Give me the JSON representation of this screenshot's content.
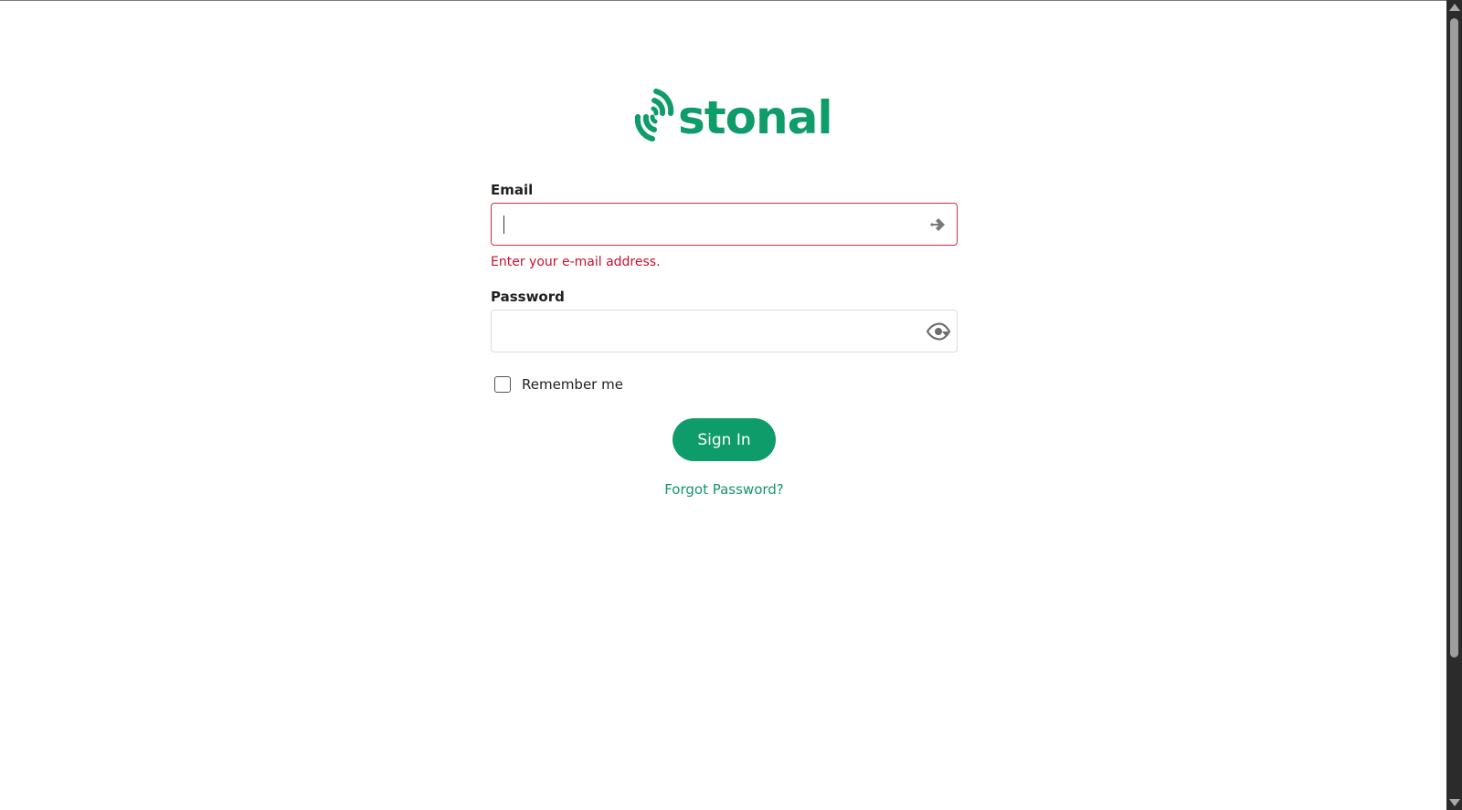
{
  "brand": {
    "name": "stonal",
    "color": "#0e9c6a",
    "logo_icon": "signal-waves-icon"
  },
  "form": {
    "email": {
      "label": "Email",
      "value": "",
      "placeholder": "",
      "error": "Enter your e-mail address.",
      "icon": "autofill-key-icon"
    },
    "password": {
      "label": "Password",
      "value": "",
      "placeholder": "",
      "icon": "eye-icon"
    },
    "remember_me": {
      "label": "Remember me",
      "checked": false
    },
    "sign_in_label": "Sign In",
    "forgot_password_label": "Forgot Password?"
  },
  "colors": {
    "accent": "#0e9c6a",
    "error": "#c8102e",
    "error_border": "#d92b43"
  }
}
